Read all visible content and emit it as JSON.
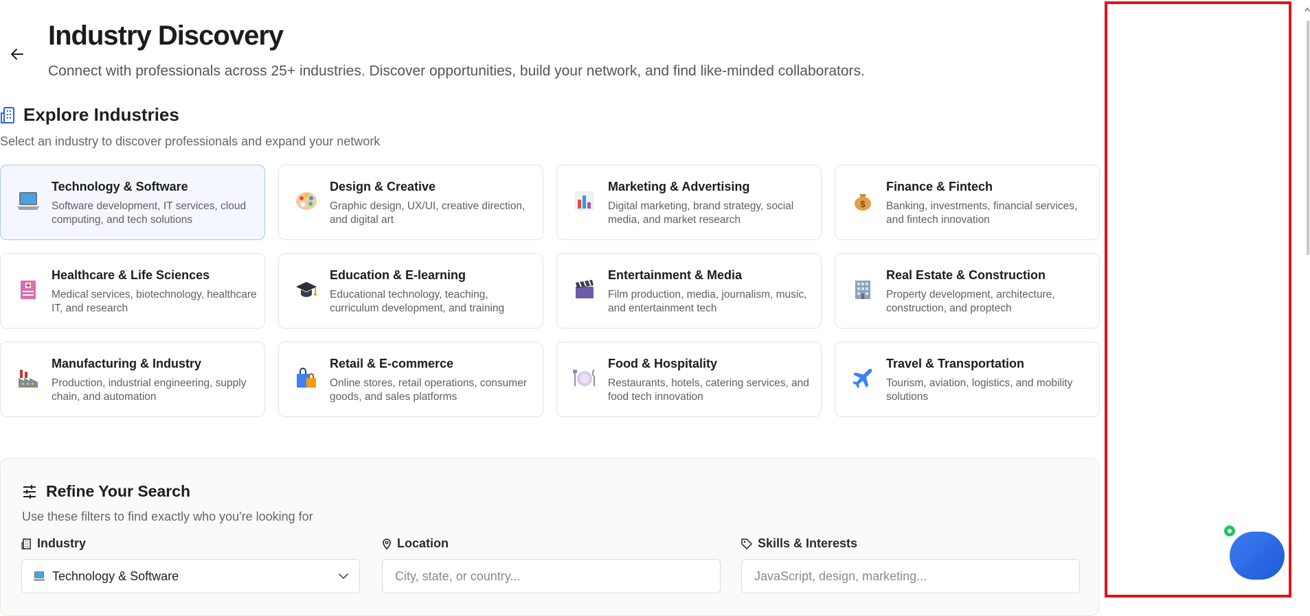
{
  "header": {
    "title": "Industry Discovery",
    "subtitle": "Connect with professionals across 25+ industries. Discover opportunities, build your network, and find like-minded collaborators."
  },
  "explore": {
    "title": "Explore Industries",
    "description": "Select an industry to discover professionals and expand your network"
  },
  "industries": [
    {
      "title": "Technology & Software",
      "description": "Software development, IT services, cloud computing, and tech solutions",
      "icon": "laptop-icon",
      "selected": true
    },
    {
      "title": "Design & Creative",
      "description": "Graphic design, UX/UI, creative direction, and digital art",
      "icon": "palette-icon"
    },
    {
      "title": "Marketing & Advertising",
      "description": "Digital marketing, brand strategy, social media, and market research",
      "icon": "bar-chart-icon"
    },
    {
      "title": "Finance & Fintech",
      "description": "Banking, investments, financial services, and fintech innovation",
      "icon": "money-bag-icon"
    },
    {
      "title": "Healthcare & Life Sciences",
      "description": "Medical services, biotechnology, healthcare IT, and research",
      "icon": "hospital-icon"
    },
    {
      "title": "Education & E-learning",
      "description": "Educational technology, teaching, curriculum development, and training",
      "icon": "graduation-cap-icon"
    },
    {
      "title": "Entertainment & Media",
      "description": "Film production, media, journalism, music, and entertainment tech",
      "icon": "clapperboard-icon"
    },
    {
      "title": "Real Estate & Construction",
      "description": "Property development, architecture, construction, and proptech",
      "icon": "office-building-icon"
    },
    {
      "title": "Manufacturing & Industry",
      "description": "Production, industrial engineering, supply chain, and automation",
      "icon": "factory-icon"
    },
    {
      "title": "Retail & E-commerce",
      "description": "Online stores, retail operations, consumer goods, and sales platforms",
      "icon": "shopping-bags-icon"
    },
    {
      "title": "Food & Hospitality",
      "description": "Restaurants, hotels, catering services, and food tech innovation",
      "icon": "plate-utensils-icon"
    },
    {
      "title": "Travel & Transportation",
      "description": "Tourism, aviation, logistics, and mobility solutions",
      "icon": "airplane-icon"
    }
  ],
  "filters": {
    "title": "Refine Your Search",
    "description": "Use these filters to find exactly who you're looking for",
    "industry": {
      "label": "Industry",
      "value": "Technology & Software"
    },
    "location": {
      "label": "Location",
      "placeholder": "City, state, or country..."
    },
    "skills": {
      "label": "Skills & Interests",
      "placeholder": "JavaScript, design, marketing..."
    }
  },
  "colors": {
    "accent": "#2563eb",
    "highlight_frame": "#e0141d",
    "online": "#22c55e"
  }
}
